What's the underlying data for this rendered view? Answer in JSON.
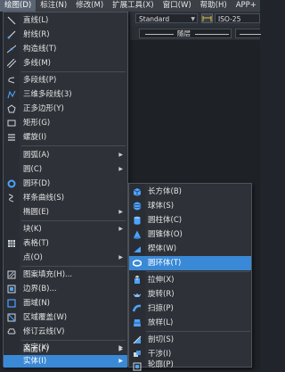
{
  "menubar": {
    "items": [
      "绘图(D)",
      "标注(N)",
      "修改(M)",
      "扩展工具(X)",
      "窗口(W)",
      "帮助(H)",
      "APP+"
    ]
  },
  "toolbar": {
    "text_style": "Standard",
    "dim_style": "ISO-25"
  },
  "layer_bar": {
    "linetype": "随层"
  },
  "draw_menu": {
    "items": [
      {
        "label": "直线(L)",
        "icon": "line-icon"
      },
      {
        "label": "射线(R)",
        "icon": "ray-icon"
      },
      {
        "label": "构造线(T)",
        "icon": "construction-line-icon"
      },
      {
        "label": "多线(M)",
        "icon": "multiline-icon"
      },
      {
        "label": "多段线(P)",
        "icon": "polyline-icon"
      },
      {
        "label": "三维多段线(3)",
        "icon": "3d-polyline-icon"
      },
      {
        "label": "正多边形(Y)",
        "icon": "polygon-icon"
      },
      {
        "label": "矩形(G)",
        "icon": "rectangle-icon"
      },
      {
        "label": "螺旋(I)",
        "icon": "helix-icon"
      },
      {
        "label": "圆弧(A)",
        "icon": "",
        "submenu": true
      },
      {
        "label": "圆(C)",
        "icon": "",
        "submenu": true
      },
      {
        "label": "圆环(D)",
        "icon": "donut-icon"
      },
      {
        "label": "样条曲线(S)",
        "icon": "spline-icon"
      },
      {
        "label": "椭圆(E)",
        "icon": "",
        "submenu": true
      },
      {
        "label": "块(K)",
        "icon": "",
        "submenu": true
      },
      {
        "label": "表格(T)",
        "icon": "table-icon"
      },
      {
        "label": "点(O)",
        "icon": "",
        "submenu": true
      },
      {
        "label": "图案填充(H)...",
        "icon": "hatch-icon"
      },
      {
        "label": "边界(B)...",
        "icon": "boundary-icon"
      },
      {
        "label": "面域(N)",
        "icon": "region-icon"
      },
      {
        "label": "区域覆盖(W)",
        "icon": "wipeout-icon"
      },
      {
        "label": "修订云线(V)",
        "icon": "revcloud-icon"
      },
      {
        "label": "文字(X)",
        "icon": "",
        "submenu": true
      },
      {
        "label": "曲面(F)",
        "icon": "",
        "submenu": true
      },
      {
        "label": "实体(I)",
        "icon": "",
        "submenu": true,
        "highlighted": true
      }
    ]
  },
  "solid_submenu": {
    "items": [
      {
        "label": "长方体(B)",
        "icon": "box-icon"
      },
      {
        "label": "球体(S)",
        "icon": "sphere-icon"
      },
      {
        "label": "圆柱体(C)",
        "icon": "cylinder-icon"
      },
      {
        "label": "圆锥体(O)",
        "icon": "cone-icon"
      },
      {
        "label": "楔体(W)",
        "icon": "wedge-icon"
      },
      {
        "label": "圆环体(T)",
        "icon": "torus-icon",
        "highlighted": true
      },
      {
        "label": "拉伸(X)",
        "icon": "extrude-icon"
      },
      {
        "label": "旋转(R)",
        "icon": "revolve-icon"
      },
      {
        "label": "扫掠(P)",
        "icon": "sweep-icon"
      },
      {
        "label": "放样(L)",
        "icon": "loft-icon"
      },
      {
        "label": "剖切(S)",
        "icon": "slice-icon"
      },
      {
        "label": "干涉(I)",
        "icon": "interference-icon"
      },
      {
        "label": "轮廓(P)",
        "icon": "profile-icon"
      }
    ]
  },
  "colors": {
    "highlight": "#3a89d6",
    "menu_bg": "#2e3238",
    "icon_blue": "#4da3ff"
  }
}
